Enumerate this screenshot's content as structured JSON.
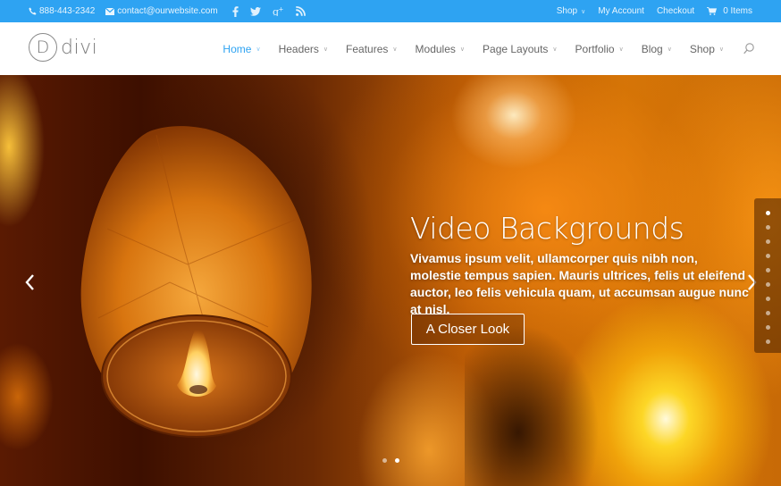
{
  "topbar": {
    "phone": "888-443-2342",
    "email": "contact@ourwebsite.com",
    "social": [
      {
        "name": "facebook",
        "icon": "facebook-icon"
      },
      {
        "name": "twitter",
        "icon": "twitter-icon"
      },
      {
        "name": "google-plus",
        "icon": "google-plus-icon"
      },
      {
        "name": "rss",
        "icon": "rss-icon"
      }
    ],
    "links": [
      {
        "label": "Shop",
        "has_dropdown": true
      },
      {
        "label": "My Account",
        "has_dropdown": false
      },
      {
        "label": "Checkout",
        "has_dropdown": false
      }
    ],
    "cart_label": "0 Items",
    "background_color": "#2ea3f2"
  },
  "header": {
    "logo_letter": "D",
    "logo_word": "divi",
    "nav": [
      {
        "label": "Home",
        "active": true
      },
      {
        "label": "Headers",
        "active": false
      },
      {
        "label": "Features",
        "active": false
      },
      {
        "label": "Modules",
        "active": false
      },
      {
        "label": "Page Layouts",
        "active": false
      },
      {
        "label": "Portfolio",
        "active": false
      },
      {
        "label": "Blog",
        "active": false
      },
      {
        "label": "Shop",
        "active": false
      }
    ],
    "accent_color": "#2ea3f2"
  },
  "hero": {
    "title": "Video Backgrounds",
    "text_bold": "Vivamus ipsum velit, ullamcorper quis nibh non, molestie tempus sapien. Mauris ultrices, felis ut eleifend auctor, leo felis vehicula quam, ut accumsan augue nunc at nisl.",
    "button_label": "A Closer Look",
    "side_nav_count": 10,
    "side_nav_active_index": 0,
    "bullet_count": 2,
    "bullet_active_index": 1
  }
}
